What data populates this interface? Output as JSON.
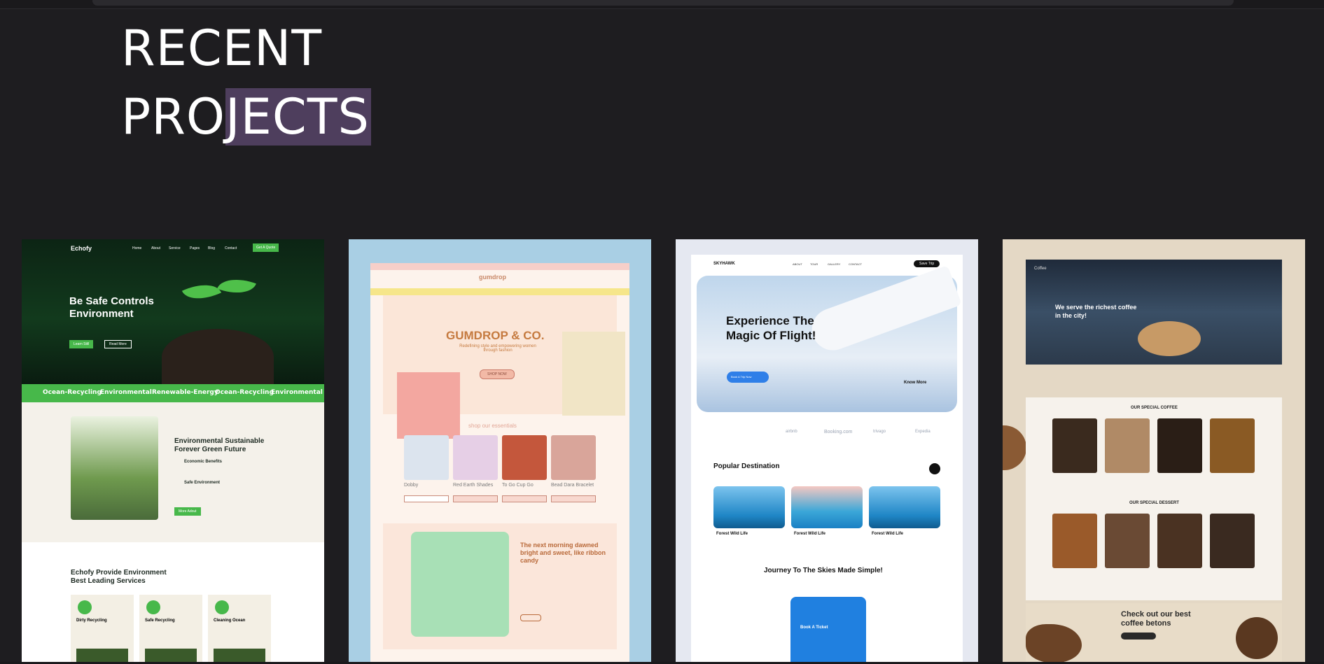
{
  "section": {
    "heading_line1": "RECENT",
    "heading_line2_plain": "PRO",
    "heading_line2_highlight": "JECTS",
    "highlight_color": "#4e3e5d",
    "background": "#1e1d20"
  },
  "projects": [
    {
      "logo": "Echofy",
      "nav": [
        "Home",
        "About",
        "Service",
        "Pages",
        "Blog",
        "Contact"
      ],
      "cta": "Get A Quote",
      "hero_title": "Be Safe Controls Environment",
      "hero_buttons": [
        "Learn Still",
        "Read More"
      ],
      "strip": [
        "Ocean-Recycling",
        "Environmental",
        "Renewable-Energy",
        "Ocean-Recycling",
        "Environmental"
      ],
      "about_title": "Environmental Sustainable Forever Green Future",
      "about_points": [
        "Economic Benefits",
        "Safe Environment"
      ],
      "about_button": "More Adout",
      "services_title": "Echofy Provide Environment Best Leading Services",
      "services": [
        "Dirty Recycling",
        "Safe Recycling",
        "Cleaning Ocean"
      ]
    },
    {
      "logo": "gumdrop",
      "hero_title": "GUMDROP & CO.",
      "hero_sub": "Redefining style and empowering women through fashion",
      "hero_button": "SHOP NOW",
      "section_title": "shop our essentials",
      "products": [
        "Dobby",
        "Red Earth Shades",
        "To Go Cup Go",
        "Bead Dara Bracelet"
      ],
      "feature_title": "The next morning dawned bright and sweet, like ribbon candy"
    },
    {
      "logo": "SKYHAWK",
      "nav": [
        "ABOUT",
        "TOUR",
        "GALLERY",
        "CONTACT"
      ],
      "nav_button": "Save Trip",
      "hero_title": "Experience The Magic Of Flight!",
      "hero_button": "Book A Trip Now",
      "know_more": "Know More",
      "partners": [
        "airbnb",
        "Booking.com",
        "trivago",
        "Expedia"
      ],
      "popular_title": "Popular Destination",
      "destinations": [
        "Forest Wild Life",
        "Forest Wild Life",
        "Forest Wild Life"
      ],
      "journey_title": "Journey To The Skies Made Simple!",
      "ticket_label": "Book A Ticket"
    },
    {
      "logo": "Coffee",
      "hero_title": "We serve the richest coffee in the city!",
      "section1": "OUR SPECIAL COFFEE",
      "section2": "OUR SPECIAL DESSERT",
      "promo_title": "Check out our best coffee betons"
    }
  ]
}
